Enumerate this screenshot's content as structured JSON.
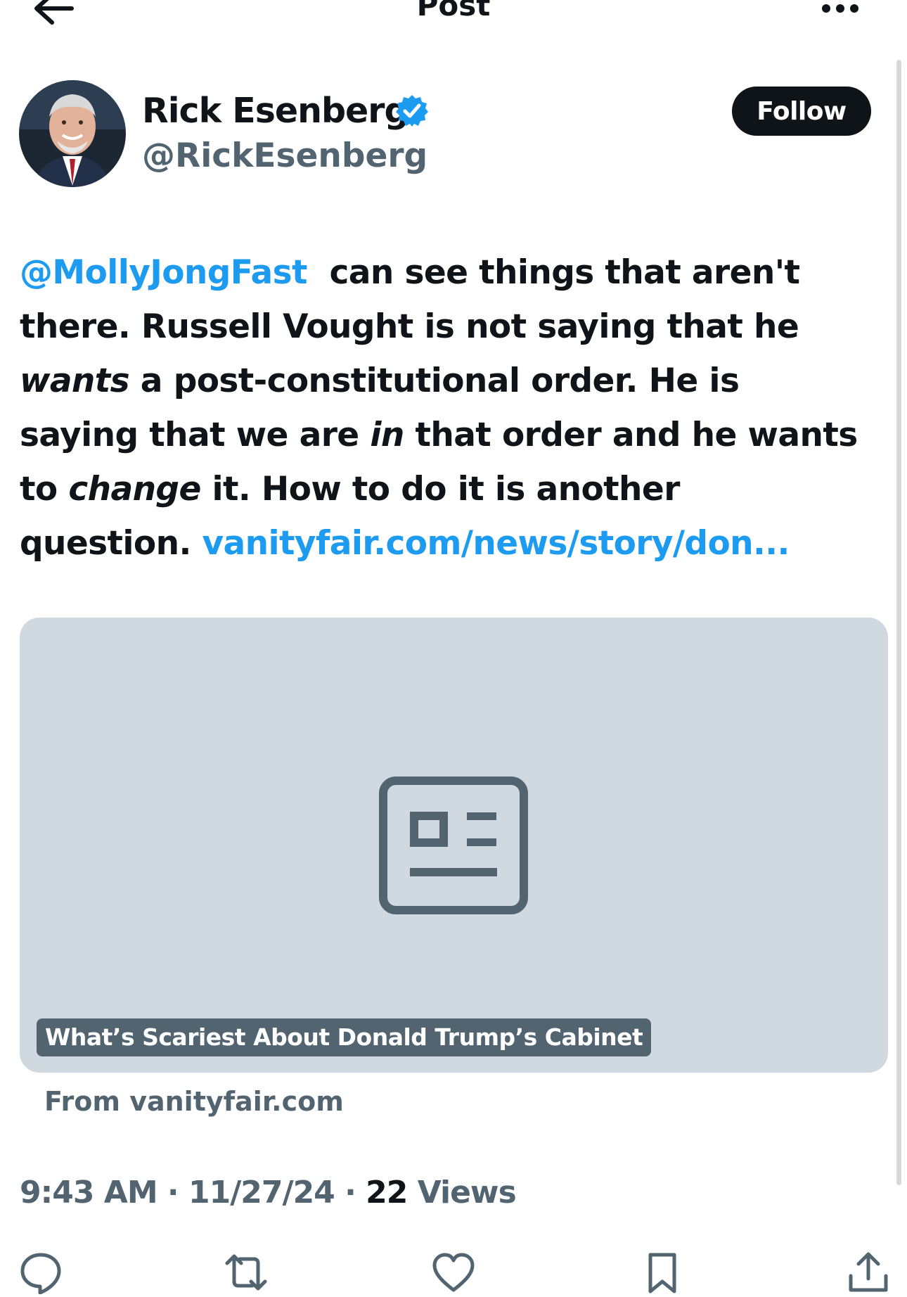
{
  "header": {
    "title": "Post",
    "back_icon": "arrow-left-icon",
    "more_icon": "more-horizontal-icon"
  },
  "author": {
    "name": "Rick Esenberg",
    "handle": "@RickEsenberg",
    "verified": true,
    "verified_icon": "verified-badge-icon",
    "follow_label": "Follow"
  },
  "post": {
    "mention": "@MollyJongFast",
    "l1": "can see things that aren't",
    "l2": "there.   Russell Vought is not saying that he",
    "l3_italic": "wants",
    "l3": " a post-constitutional order. He is",
    "l4a": "saying that we are ",
    "l4_italic": "in",
    "l4b": " that order and he wants",
    "l5a": "to ",
    "l5_italic": "change",
    "l5b": " it. How to do it is another",
    "l6": "question. ",
    "link": "vanityfair.com/news/story/don..."
  },
  "card": {
    "title": "What’s Scariest About Donald Trump’s Cabinet",
    "source": "From vanityfair.com",
    "icon": "article-icon"
  },
  "meta": {
    "time": "9:43 AM",
    "separator": " · ",
    "date": "11/27/24",
    "views_count": "22",
    "views_label": " Views"
  },
  "actions": [
    "reply-icon",
    "repost-icon",
    "like-icon",
    "bookmark-icon",
    "share-icon"
  ],
  "colors": {
    "accent": "#1d9bf0",
    "text": "#0f1419",
    "muted": "#536471",
    "card_bg": "#cfd9df"
  }
}
